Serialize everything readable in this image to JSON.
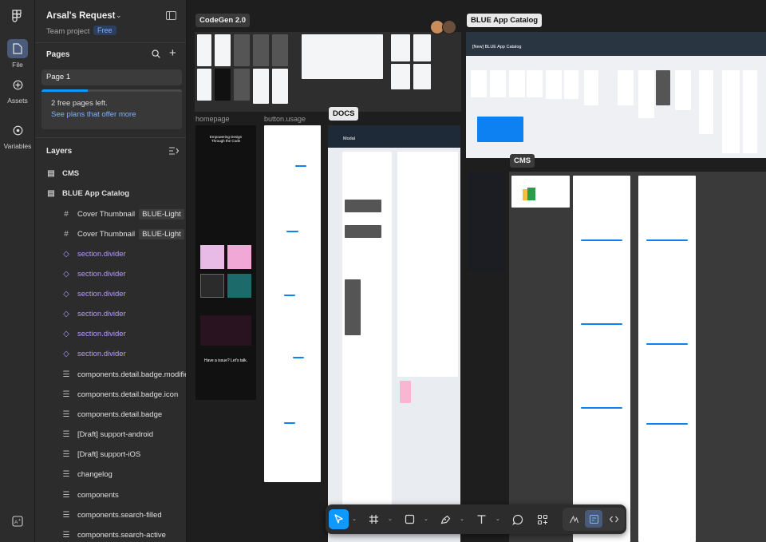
{
  "app": {
    "file_title": "Arsal's Request",
    "team": "Team project",
    "plan_badge": "Free"
  },
  "rail": {
    "file_label": "File",
    "assets_label": "Assets",
    "variables_label": "Variables"
  },
  "pages": {
    "title": "Pages",
    "items": [
      "Page 1"
    ],
    "notice_text": "2 free pages left.",
    "notice_link": "See plans that offer more",
    "usage_fraction": 0.33
  },
  "layers": {
    "title": "Layers",
    "items": [
      {
        "label": "CMS",
        "tag": ""
      },
      {
        "label": "BLUE App Catalog",
        "tag": ""
      },
      {
        "label": "Cover Thumbnail",
        "tag": "BLUE-Light"
      },
      {
        "label": "Cover Thumbnail",
        "tag": "BLUE-Light"
      },
      {
        "label": "section.divider",
        "tag": ""
      },
      {
        "label": "section.divider",
        "tag": ""
      },
      {
        "label": "section.divider",
        "tag": ""
      },
      {
        "label": "section.divider",
        "tag": ""
      },
      {
        "label": "section.divider",
        "tag": ""
      },
      {
        "label": "section.divider",
        "tag": ""
      },
      {
        "label": "components.detail.badge.modifie",
        "tag": ""
      },
      {
        "label": "components.detail.badge.icon",
        "tag": ""
      },
      {
        "label": "components.detail.badge",
        "tag": ""
      },
      {
        "label": "[Draft] support-android",
        "tag": ""
      },
      {
        "label": "[Draft] support-iOS",
        "tag": ""
      },
      {
        "label": "changelog",
        "tag": ""
      },
      {
        "label": "components",
        "tag": ""
      },
      {
        "label": "components.search-filled",
        "tag": ""
      },
      {
        "label": "components.search-active",
        "tag": ""
      }
    ]
  },
  "canvas": {
    "labels": {
      "codegen": "CodeGen 2.0",
      "blue_catalog": "BLUE App Catalog",
      "docs": "DOCS",
      "cms": "CMS",
      "homepage": "homepage",
      "button_usage": "button.usage"
    },
    "catalog_header": "[New] BLUE App Catalog",
    "docs_page_title": "Modal",
    "homepage_hero": "Empowering Design Through the Code",
    "homepage_footer": "Have a issue? Let's talk."
  },
  "toolbar": {
    "tools": [
      "move-tool",
      "frame-tool",
      "shape-tool",
      "pen-tool",
      "text-tool",
      "comment-tool",
      "actions-tool"
    ],
    "selected": "move-tool",
    "modes": [
      "draw-mode",
      "design-mode",
      "dev-mode"
    ],
    "active_mode": "design-mode"
  },
  "colors": {
    "accent": "#0d99ff",
    "panel": "#2c2c2c",
    "canvas": "#1e1e1e",
    "layer_component": "#b59bff",
    "link": "#7fb0ff"
  }
}
